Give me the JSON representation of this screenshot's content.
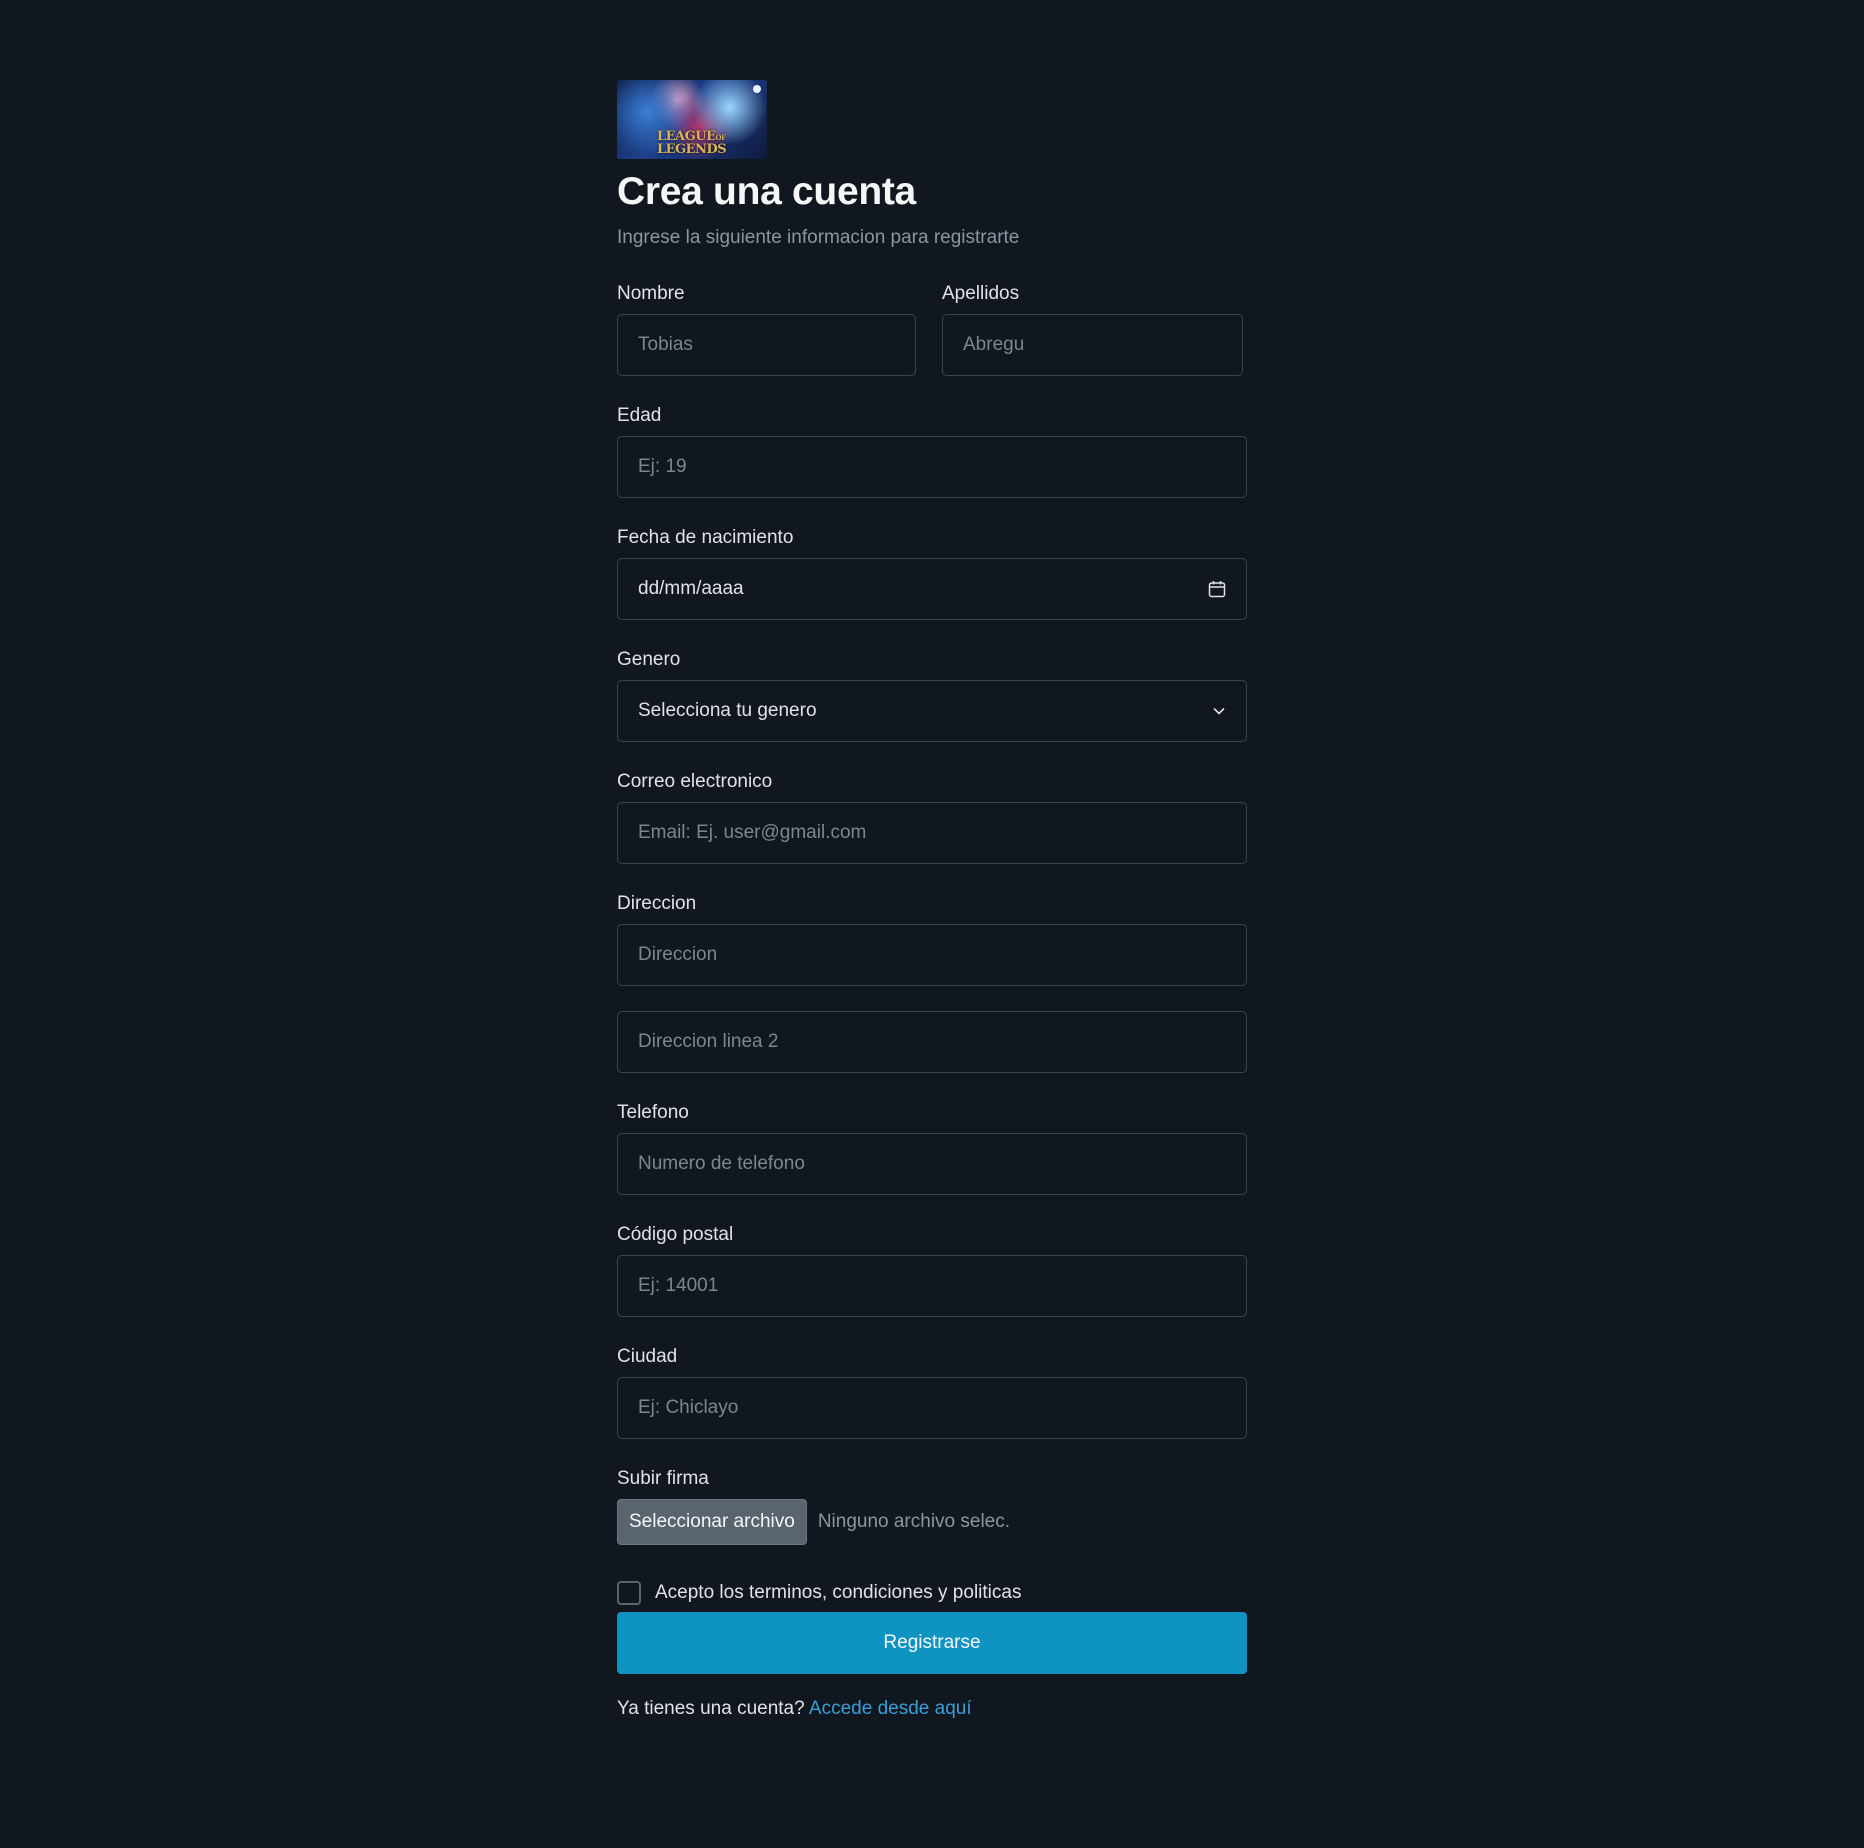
{
  "logo": {
    "line1": "LEAGUE",
    "of": "OF",
    "line2": "LEGENDS"
  },
  "title": "Crea una cuenta",
  "subtitle": "Ingrese la siguiente informacion para registrarte",
  "fields": {
    "nombre": {
      "label": "Nombre",
      "placeholder": "Tobias"
    },
    "apellidos": {
      "label": "Apellidos",
      "placeholder": "Abregu"
    },
    "edad": {
      "label": "Edad",
      "placeholder": "Ej: 19"
    },
    "fecha": {
      "label": "Fecha de nacimiento",
      "value": "dd/mm/aaaa",
      "icon": "calendar-icon"
    },
    "genero": {
      "label": "Genero",
      "selected": "Selecciona tu genero",
      "icon": "chevron-down-icon"
    },
    "correo": {
      "label": "Correo electronico",
      "placeholder": "Email: Ej. user@gmail.com"
    },
    "direccion": {
      "label": "Direccion",
      "placeholder": "Direccion",
      "placeholder2": "Direccion linea 2"
    },
    "telefono": {
      "label": "Telefono",
      "placeholder": "Numero de telefono"
    },
    "codigo_postal": {
      "label": "Código postal",
      "placeholder": "Ej: 14001"
    },
    "ciudad": {
      "label": "Ciudad",
      "placeholder": "Ej: Chiclayo"
    },
    "firma": {
      "label": "Subir firma",
      "button": "Seleccionar archivo",
      "status": "Ninguno archivo selec."
    }
  },
  "terms": {
    "label": "Acepto los terminos, condiciones y politicas",
    "checked": false
  },
  "submit_label": "Registrarse",
  "footer": {
    "text": "Ya tienes una cuenta?",
    "link": "Accede desde aquí"
  },
  "colors": {
    "background": "#10171f",
    "accent": "#0f93c1",
    "link": "#3a9ed8",
    "border": "#3b434c"
  }
}
